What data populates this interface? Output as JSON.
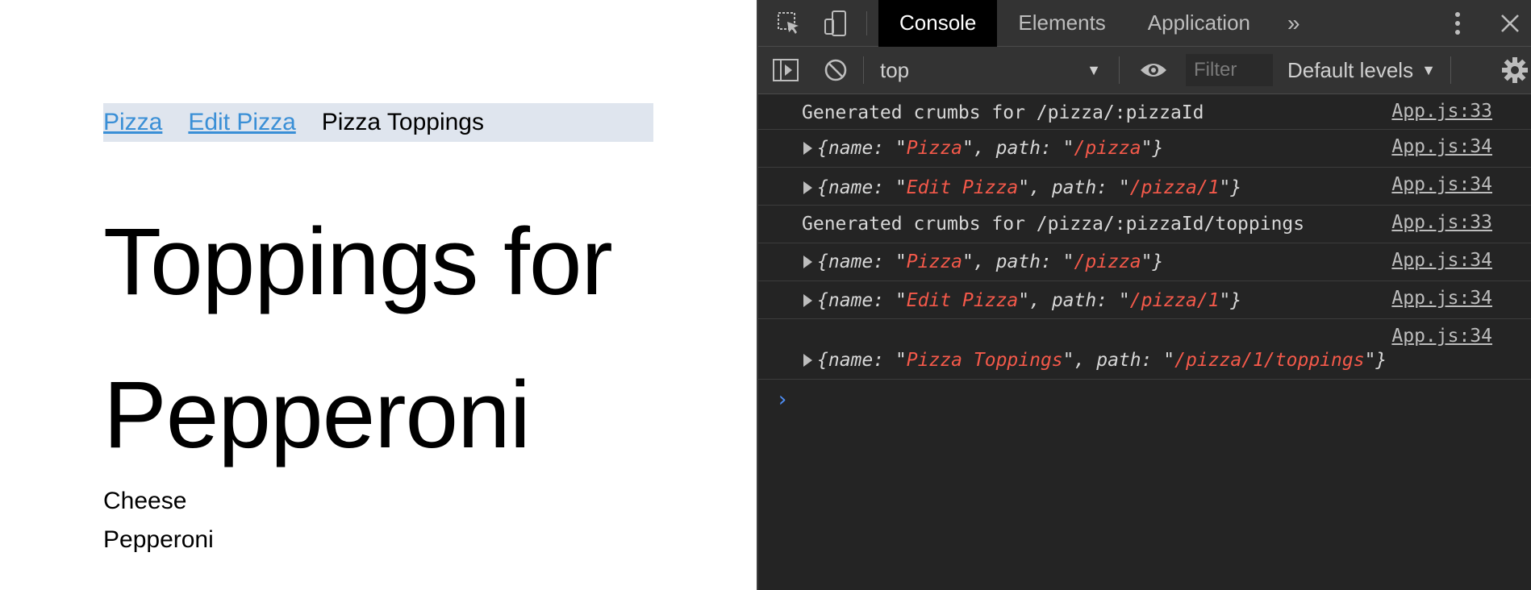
{
  "page": {
    "breadcrumbs": [
      {
        "label": "Pizza"
      },
      {
        "label": "Edit Pizza"
      },
      {
        "label": "Pizza Toppings"
      }
    ],
    "title": "Toppings for Pepperoni",
    "toppings": [
      "Cheese",
      "Pepperoni"
    ]
  },
  "devtools": {
    "tabs": [
      "Console",
      "Elements",
      "Application"
    ],
    "active_tab": "Console",
    "more_tabs_glyph": "»",
    "context": "top",
    "filter_placeholder": "Filter",
    "levels": "Default levels",
    "console": [
      {
        "type": "log",
        "text": "Generated crumbs for /pizza/:pizzaId",
        "source": "App.js:33"
      },
      {
        "type": "object",
        "name": "Pizza",
        "path": "/pizza",
        "source": "App.js:34"
      },
      {
        "type": "object",
        "name": "Edit Pizza",
        "path": "/pizza/1",
        "source": "App.js:34"
      },
      {
        "type": "log",
        "text": "Generated crumbs for /pizza/:pizzaId/toppings",
        "source": "App.js:33"
      },
      {
        "type": "object",
        "name": "Pizza",
        "path": "/pizza",
        "source": "App.js:34"
      },
      {
        "type": "object",
        "name": "Edit Pizza",
        "path": "/pizza/1",
        "source": "App.js:34"
      },
      {
        "type": "object",
        "name": "Pizza Toppings",
        "path": "/pizza/1/toppings",
        "source": "App.js:34"
      }
    ],
    "prompt_glyph": "›",
    "colors": {
      "string": "#f4594a",
      "link": "#3a8fd6",
      "prompt": "#4f8ff7",
      "breadcrumb_bg": "#dfe5ee"
    }
  }
}
